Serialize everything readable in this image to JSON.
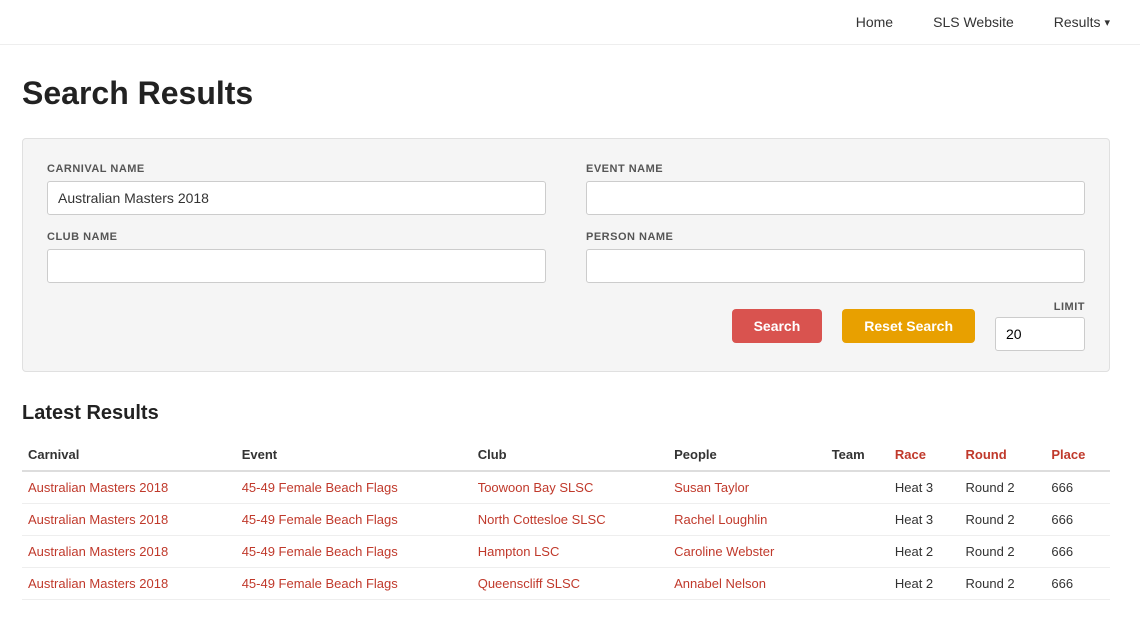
{
  "nav": {
    "home": "Home",
    "sls_website": "SLS Website",
    "results": "Results",
    "results_chevron": "▾"
  },
  "page": {
    "title": "Search Results"
  },
  "form": {
    "carnival_name_label": "CARNIVAL NAME",
    "carnival_name_value": "Australian Masters 2018",
    "event_name_label": "EVENT NAME",
    "event_name_value": "",
    "club_name_label": "CLUB NAME",
    "club_name_value": "",
    "person_name_label": "PERSON NAME",
    "person_name_value": "",
    "limit_label": "LIMIT",
    "limit_value": "20",
    "search_button": "Search",
    "reset_button": "Reset Search"
  },
  "results": {
    "section_title": "Latest Results",
    "columns": {
      "carnival": "Carnival",
      "event": "Event",
      "club": "Club",
      "people": "People",
      "team": "Team",
      "race": "Race",
      "round": "Round",
      "place": "Place"
    },
    "rows": [
      {
        "carnival": "Australian Masters 2018",
        "event": "45-49 Female Beach Flags",
        "club": "Toowoon Bay SLSC",
        "people": "Susan Taylor",
        "team": "",
        "race": "Heat 3",
        "round": "Round 2",
        "place": "666"
      },
      {
        "carnival": "Australian Masters 2018",
        "event": "45-49 Female Beach Flags",
        "club": "North Cottesloe SLSC",
        "people": "Rachel Loughlin",
        "team": "",
        "race": "Heat 3",
        "round": "Round 2",
        "place": "666"
      },
      {
        "carnival": "Australian Masters 2018",
        "event": "45-49 Female Beach Flags",
        "club": "Hampton LSC",
        "people": "Caroline Webster",
        "team": "",
        "race": "Heat 2",
        "round": "Round 2",
        "place": "666"
      },
      {
        "carnival": "Australian Masters 2018",
        "event": "45-49 Female Beach Flags",
        "club": "Queenscliff SLSC",
        "people": "Annabel Nelson",
        "team": "",
        "race": "Heat 2",
        "round": "Round 2",
        "place": "666"
      }
    ]
  }
}
